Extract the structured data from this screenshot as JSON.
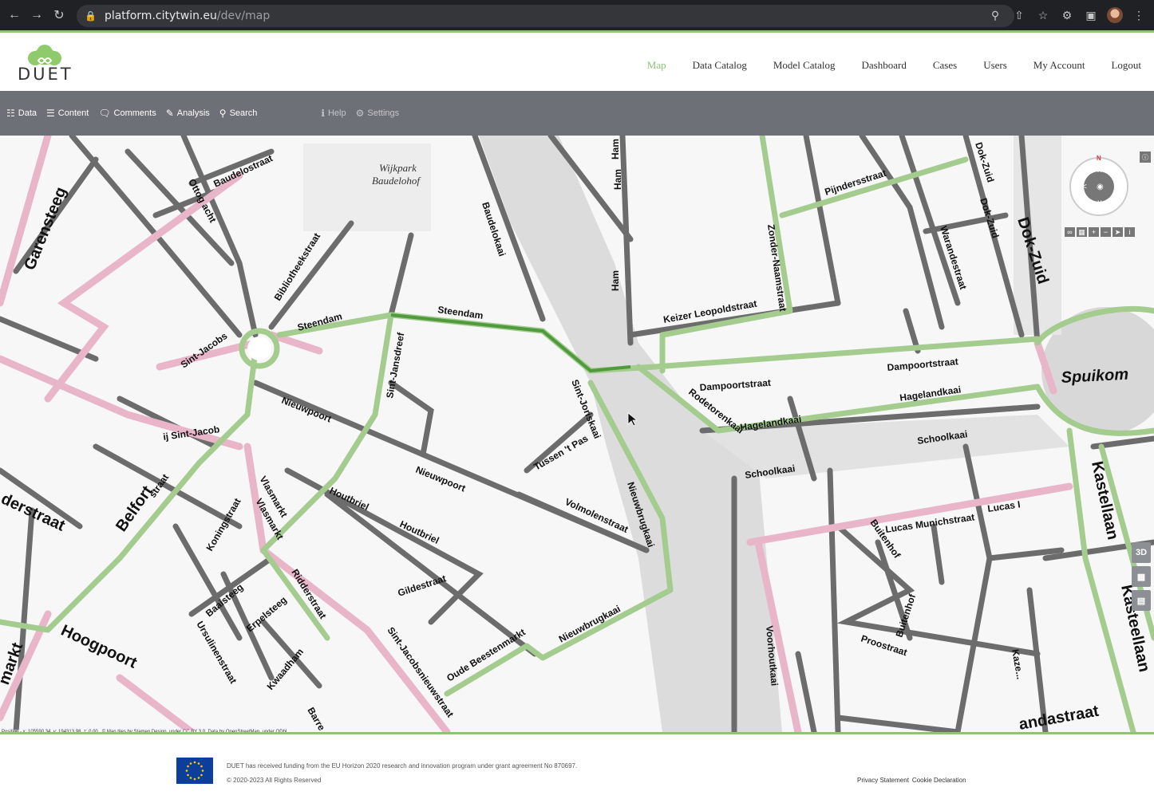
{
  "browser": {
    "url_host": "platform.citytwin.eu",
    "url_path": "/dev/map"
  },
  "brand": {
    "name": "DUET",
    "accent": "#8fc27a"
  },
  "nav": {
    "items": [
      {
        "label": "Map",
        "active": true
      },
      {
        "label": "Data Catalog"
      },
      {
        "label": "Model Catalog"
      },
      {
        "label": "Dashboard"
      },
      {
        "label": "Cases"
      },
      {
        "label": "Users"
      },
      {
        "label": "My Account"
      },
      {
        "label": "Logout"
      }
    ]
  },
  "toolbar": {
    "data": "Data",
    "content": "Content",
    "comments": "Comments",
    "analysis": "Analysis",
    "search": "Search",
    "help": "Help",
    "settings": "Settings"
  },
  "map": {
    "labels": {
      "wijkpark1": "Wijkpark",
      "wijkpark2": "Baudelohof",
      "baudelostraat": "Baudelostraat",
      "ottogracht": "Ottog acht",
      "garensteeg": "Garensteeg",
      "bibliotheekstraat": "Bibliotheekstraat",
      "steendam1": "Steendam",
      "steendam2": "Steendam",
      "sintjacobs": "Sint-Jacobs",
      "baudelokaai": "Baudelokaai",
      "ham1": "Ham",
      "ham2": "Ham",
      "ham3": "Ham",
      "sintjansdreef": "Sint-Jansdreef",
      "nieuwpoort1": "Nieuwpoort",
      "nieuwpoort2": "Nieuwpoort",
      "sintjacob2": "ij Sint-Jacob",
      "belfort": "Belfort",
      "belfortstraat": "straat",
      "derstraat": "derstraat",
      "koningstraat": "Koningstraat",
      "vlasmarkt1": "Vlasmarkt",
      "vlasmarkt2": "Vlasmarkt",
      "houtbriel1": "Houtbriel",
      "houtbriel2": "Houtbriel",
      "tussentpas": "Tussen 't Pas",
      "sintjoriskaai": "Sint-Joriskaai",
      "volmolenstraat": "Volmolenstraat",
      "nieuwbrugkaai1": "Nieuwbrugkaai",
      "nieuwbrugkaai2": "Nieuwbrugkaai",
      "gildestraat": "Gildestraat",
      "ridderstraat": "Ridderstraat",
      "baaisteeg": "Baaisteeg",
      "erpelsteeg": "Erpelsteeg",
      "ursulinenstraat": "Ursulinenstraat",
      "kwaadham": "Kwaadham",
      "hoogpoort": "Hoogpoort",
      "markt": "markt",
      "sintjacobsnieuwstraat": "Sint-Jacobsnieuwstraat",
      "oudebeestenmarkt": "Oude Beestenmarkt",
      "barre": "Barre",
      "pijndersstraat": "Pijndersstraat",
      "dokzuid1": "Dok-Zuid",
      "dokzuid2": "Dok-Zuid",
      "dokzuid3": "Dok-Zuid",
      "zondernaamstraat": "Zonder-Naamstraat",
      "warandestraat": "Warandestraat",
      "keizerleopoldstraat": "Keizer Leopoldstraat",
      "dampoortstraat1": "Dampoortstraat",
      "dampoortstraat2": "Dampoortstraat",
      "rodetorenkaai": "Rodetorenkaai",
      "hagelandkaai1": "Hagelandkaai",
      "hagelandkaai2": "Hagelandkaai",
      "spuikom": "Spuikom",
      "schoolkaai1": "Schoolkaai",
      "schoolkaai2": "Schoolkaai",
      "lucasmunichstraat": "Lucas Munichstraat",
      "lucas2": "Lucas I",
      "buitenhof1": "Buitenhof",
      "buitenhof2": "Buitenhof",
      "proostraat": "Proostraat",
      "voorhoutkaai": "Voorhoutkaai",
      "kazer": "Kaze...",
      "andastraat": "andastraat",
      "kasteellaan1": "Kastellaan",
      "kasteellaan2": "Kasteellaan"
    },
    "position": "Position - x: 105590.34, y: 194313.98, z: 0.00",
    "credit": "© Map tiles by Stamen Design, under CC BY 3.0. Data by OpenStreetMap, under ODbL.",
    "compass_n": "N",
    "btn_3d": "3D"
  },
  "footer": {
    "funding": "DUET has received funding from the EU Horizon 2020 research and innovation program under grant agreement No 870697.",
    "copyright": "© 2020-2023 All Rights Reserved",
    "privacy": "Privacy Statement",
    "cookie": "Cookie Declaration"
  }
}
